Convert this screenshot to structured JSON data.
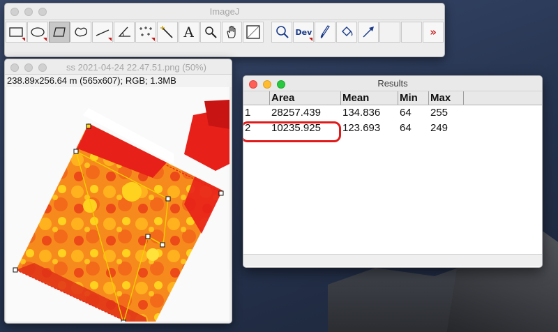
{
  "imagej": {
    "title": "ImageJ",
    "tools": [
      {
        "name": "rectangle-selection-tool",
        "icon": "rectangle-icon"
      },
      {
        "name": "oval-selection-tool",
        "icon": "oval-icon"
      },
      {
        "name": "polygon-selection-tool",
        "icon": "polygon-icon",
        "active": true
      },
      {
        "name": "freehand-selection-tool",
        "icon": "freehand-icon"
      },
      {
        "name": "line-selection-tool",
        "icon": "line-icon"
      },
      {
        "name": "angle-tool",
        "icon": "angle-icon"
      },
      {
        "name": "multi-point-tool",
        "icon": "multi-point-icon"
      },
      {
        "name": "wand-tool",
        "icon": "wand-icon"
      },
      {
        "name": "text-tool",
        "icon": "text-icon",
        "label": "A"
      },
      {
        "name": "magnifying-glass-tool",
        "icon": "magnifier-icon"
      },
      {
        "name": "scrolling-tool",
        "icon": "hand-icon"
      },
      {
        "name": "color-picker-tool",
        "icon": "color-picker-icon"
      },
      {
        "name": "zoom-tool",
        "icon": "zoom-icon"
      },
      {
        "name": "developer-menu-tool",
        "icon": "dev-icon",
        "label": "Dev"
      },
      {
        "name": "brush-tool",
        "icon": "brush-icon"
      },
      {
        "name": "flood-fill-tool",
        "icon": "flood-fill-icon"
      },
      {
        "name": "arrow-tool",
        "icon": "arrow-icon"
      },
      {
        "name": "more-tools-button",
        "icon": "double-chevron-icon",
        "label": "»"
      }
    ]
  },
  "image_window": {
    "title": "ss 2021-04-24 22.47.51.png (50%)",
    "info": "238.89x256.64 m (565x607); RGB; 1.3MB"
  },
  "results": {
    "title": "Results",
    "columns": [
      "",
      "Area",
      "Mean",
      "Min",
      "Max"
    ],
    "rows": [
      {
        "index": "1",
        "area": "28257.439",
        "mean": "134.836",
        "min": "64",
        "max": "255"
      },
      {
        "index": "2",
        "area": "10235.925",
        "mean": "123.693",
        "min": "64",
        "max": "249"
      }
    ],
    "highlight_color": "#e01a1a"
  },
  "colors": {
    "heat_red": "#e8201a",
    "heat_orange": "#f78a1c",
    "heat_yellow": "#ffd21f",
    "selection_yellow": "#f2d200"
  }
}
